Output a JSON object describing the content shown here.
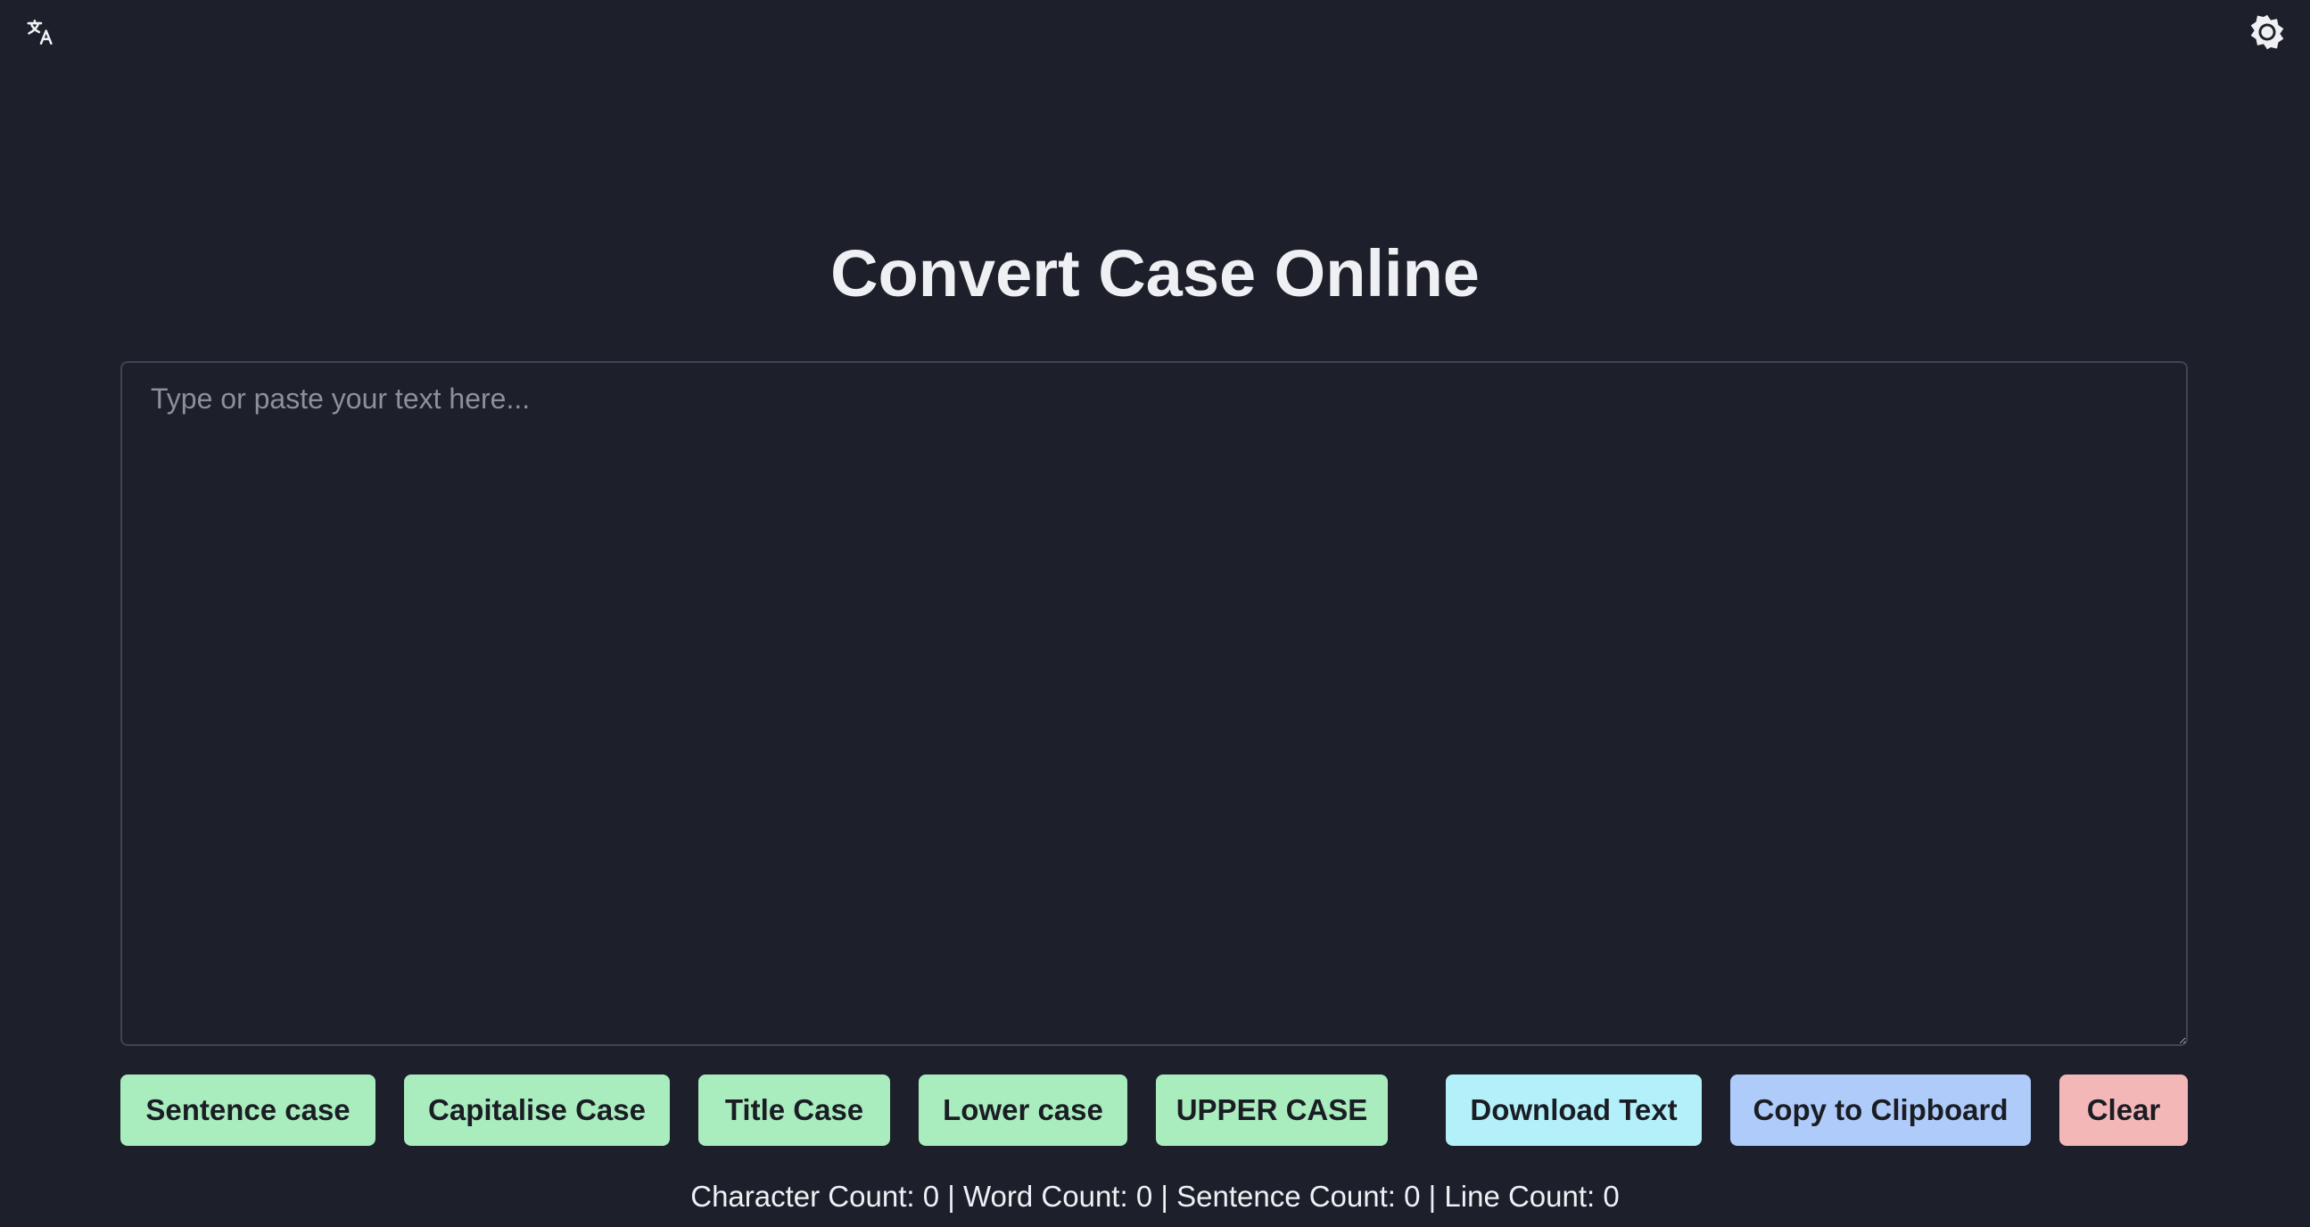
{
  "header": {
    "language_icon": "translate-icon",
    "theme_icon": "sun-icon"
  },
  "main": {
    "title": "Convert Case Online",
    "editor": {
      "placeholder": "Type or paste your text here...",
      "value": ""
    },
    "case_buttons": {
      "sentence": "Sentence case",
      "capitalise": "Capitalise Case",
      "title": "Title Case",
      "lower": "Lower case",
      "upper": "UPPER CASE"
    },
    "action_buttons": {
      "download": "Download Text",
      "copy": "Copy to Clipboard",
      "clear": "Clear"
    },
    "stats": {
      "character_label": "Character Count:",
      "character_count": "0",
      "word_label": "Word Count:",
      "word_count": "0",
      "sentence_label": "Sentence Count:",
      "sentence_count": "0",
      "line_label": "Line Count:",
      "line_count": "0",
      "separator": "|"
    }
  },
  "colors": {
    "background": "#1d202a",
    "case_button": "#a9ecbd",
    "download_button": "#b3f0fa",
    "copy_button": "#aecbfa",
    "clear_button": "#f4b7b7"
  }
}
